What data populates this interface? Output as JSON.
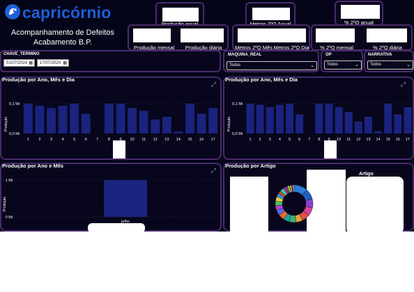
{
  "header": {
    "logo_text": "capricórnio",
    "title_line1": "Acompanhamento de Defeitos",
    "title_line2": "Acabamento B.P."
  },
  "kpis": {
    "producao_anual": "Produção anual",
    "metros_2q_anual": "Metros 2ºQ Anual",
    "pct_2q_anual": "% 2ºQ anual",
    "producao_mensal": "Produção mensal",
    "producao_diaria": "Produção diária",
    "metros_2q_mes": "Metros 2ºQ Mês",
    "metros_2q_dia": "Metros 2ºQ Dia",
    "pct_2q_mensal": "% 2ºQ mensal",
    "pct_2q_diaria": "% 2ºQ diária"
  },
  "filters": {
    "date_label": "CHAVE_TERMINO",
    "date_from": "01/07/2024",
    "date_to": "17/07/2024",
    "maquina_label": "MAQUINA_REAL",
    "maquina_value": "Todos",
    "op_label": "OP",
    "op_value": "Todos",
    "narrativa_label": "NARRATIVA",
    "narrativa_value": "Todos"
  },
  "colors": {
    "bar": "#1a237e",
    "panel_border": "#4a2a6a",
    "background": "#05051a",
    "logo": "#1f5fd6"
  },
  "icons": {
    "expand": "expand-icon",
    "calendar": "calendar-icon",
    "chevron": "chevron-down-icon",
    "logo": "capricorn-logo-icon"
  },
  "chart_data": [
    {
      "type": "bar",
      "title": "Produção por Ano, Mês e Dia",
      "ylabel": "Produção",
      "yticks": [
        "0,1 Mi",
        "0,0 Mi"
      ],
      "ylim": [
        0,
        0.1
      ],
      "categories": [
        "1",
        "2",
        "3",
        "4",
        "5",
        "6",
        "7",
        "8",
        "9",
        "10",
        "11",
        "12",
        "13",
        "14",
        "15",
        "16",
        "17"
      ],
      "values": [
        0.1,
        0.093,
        0.085,
        0.093,
        0.1,
        0.066,
        0,
        0.1,
        0.1,
        0.085,
        0.076,
        0.047,
        0.056,
        0.007,
        0.1,
        0.066,
        0.085
      ]
    },
    {
      "type": "bar",
      "title": "Produção por Ano, Mês e Dia",
      "ylabel": "Produção",
      "yticks": [
        "0,1 Mi",
        "0,0 Mi"
      ],
      "ylim": [
        0,
        0.1
      ],
      "categories": [
        "1",
        "2",
        "3",
        "4",
        "5",
        "6",
        "7",
        "8",
        "9",
        "10",
        "11",
        "12",
        "13",
        "14",
        "15",
        "16",
        "17"
      ],
      "values": [
        0.1,
        0.096,
        0.088,
        0.096,
        0.1,
        0.064,
        0,
        0.1,
        0.1,
        0.088,
        0.072,
        0.04,
        0.056,
        0.008,
        0.1,
        0.064,
        0.088
      ]
    },
    {
      "type": "bar",
      "title": "Produção por Ano e Mês",
      "ylabel": "Produção",
      "yticks": [
        "1 Mi",
        "0 Mi"
      ],
      "ylim": [
        0,
        1
      ],
      "categories": [
        "julho"
      ],
      "values": [
        1.0
      ]
    },
    {
      "type": "pie",
      "title": "Produção por Artigo",
      "legend_title": "Artigo",
      "slices": [
        12,
        9,
        8,
        7,
        7,
        6,
        6,
        5,
        5,
        5,
        4,
        4,
        4,
        3,
        3,
        3,
        2,
        2,
        2,
        2,
        1,
        1
      ],
      "colors": [
        "#2b7bd6",
        "#1e5fc0",
        "#8a3fcf",
        "#d6449a",
        "#e0504a",
        "#e5a23a",
        "#3bb273",
        "#1ea5a5",
        "#f06a2a",
        "#5a6be0",
        "#c23fd6",
        "#49c35a",
        "#e3d03a",
        "#3a8fe0",
        "#b05a2a",
        "#2ad6c5",
        "#d63a5a",
        "#6a3ad6",
        "#8ad63a",
        "#d68a3a",
        "#3a5ad6",
        "#d6d6d6"
      ]
    }
  ]
}
